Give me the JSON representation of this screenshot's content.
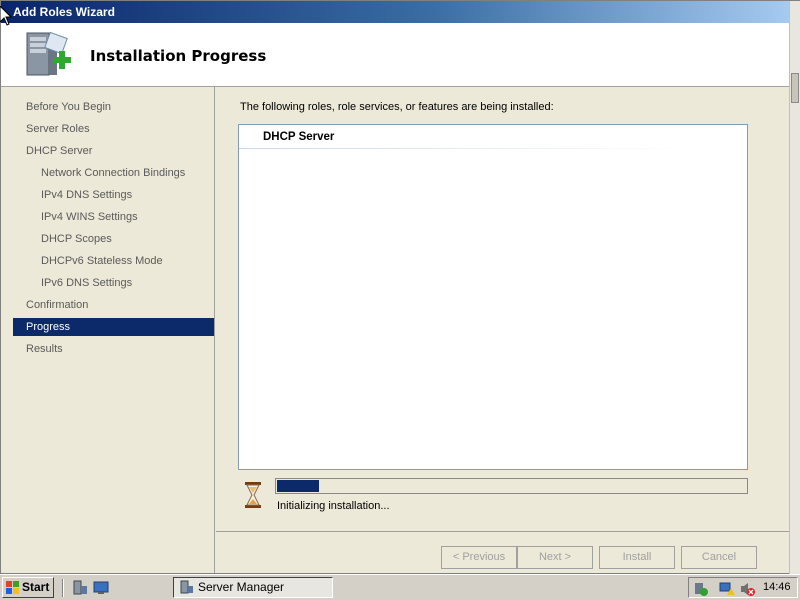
{
  "window": {
    "title": "Add Roles Wizard",
    "header_title": "Installation Progress"
  },
  "nav": {
    "items": [
      {
        "label": "Before You Begin",
        "sub": false,
        "active": false
      },
      {
        "label": "Server Roles",
        "sub": false,
        "active": false
      },
      {
        "label": "DHCP Server",
        "sub": false,
        "active": false
      },
      {
        "label": "Network Connection Bindings",
        "sub": true,
        "active": false
      },
      {
        "label": "IPv4 DNS Settings",
        "sub": true,
        "active": false
      },
      {
        "label": "IPv4 WINS Settings",
        "sub": true,
        "active": false
      },
      {
        "label": "DHCP Scopes",
        "sub": true,
        "active": false
      },
      {
        "label": "DHCPv6 Stateless Mode",
        "sub": true,
        "active": false
      },
      {
        "label": "IPv6 DNS Settings",
        "sub": true,
        "active": false
      },
      {
        "label": "Confirmation",
        "sub": false,
        "active": false
      },
      {
        "label": "Progress",
        "sub": false,
        "active": true
      },
      {
        "label": "Results",
        "sub": false,
        "active": false
      }
    ]
  },
  "content": {
    "intro": "The following roles, role services, or features are being installed:",
    "installing_items": [
      "DHCP Server"
    ],
    "progress_percent": 9,
    "status": "Initializing installation..."
  },
  "buttons": {
    "previous": "< Previous",
    "next": "Next >",
    "install": "Install",
    "cancel": "Cancel"
  },
  "taskbar": {
    "start_label": "Start",
    "task_label": "Server Manager",
    "clock": "14:46"
  },
  "colors": {
    "active_nav": "#0c2a6a",
    "progress_fill": "#0c2a6a"
  }
}
